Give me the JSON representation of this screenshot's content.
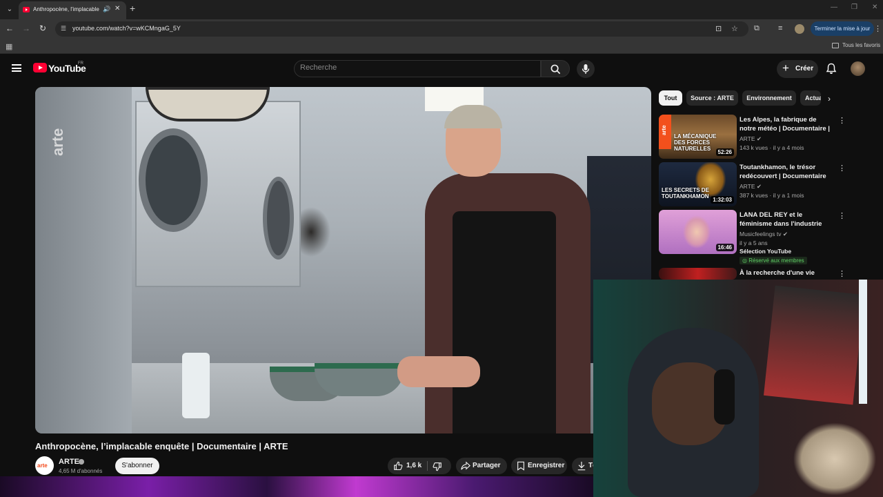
{
  "browser": {
    "tab_title": "Anthropocène, l'implacable enquête | Documentaire | ARTE",
    "url": "youtube.com/watch?v=wKCMngaG_5Y",
    "update_button": "Terminer la mise à jour",
    "bookmarks_all": "Tous les favoris"
  },
  "header": {
    "logo_text": "YouTube",
    "country_code": "FR",
    "search_placeholder": "Recherche",
    "create_label": "Créer"
  },
  "video": {
    "title": "Anthropocène, l’implacable enquête | Documentaire | ARTE",
    "watermark": "arte",
    "channel": {
      "avatar_text": "arte",
      "name": "ARTE",
      "subscribers": "4,65 M d'abonnés",
      "subscribe_label": "S'abonner"
    },
    "actions": {
      "likes": "1,6 k",
      "share": "Partager",
      "save": "Enregistrer",
      "download": "Télécharger"
    }
  },
  "chips": [
    {
      "label": "Tout",
      "active": true
    },
    {
      "label": "Source : ARTE",
      "active": false
    },
    {
      "label": "Environnement",
      "active": false
    },
    {
      "label": "Actualités",
      "active": false
    }
  ],
  "recommendations": [
    {
      "title": "Les Alpes, la fabrique de notre météo | Documentaire | ARTE",
      "channel": "ARTE",
      "meta": "143 k vues · il y a 4 mois",
      "duration": "52:26",
      "thumb_text": "LA MÉCANIQUE DES FORCES NATURELLES",
      "thumb_brand": "arte"
    },
    {
      "title": "Toutankhamon, le trésor redécouvert | Documentaire ...",
      "channel": "ARTE",
      "meta": "387 k vues · il y a 1 mois",
      "duration": "1:32:03",
      "thumb_text": "LES SECRETS DE TOUTANKHAMON"
    },
    {
      "title": "LANA DEL REY et le féminisme dans l'industrie du disque.",
      "channel": "Musicfeelings tv",
      "meta": "il y a 5 ans",
      "duration": "16:46",
      "selection": "Sélection YouTube",
      "badge": "Réservé aux membres"
    },
    {
      "title": "À la recherche d'une vie"
    }
  ],
  "colors": {
    "yt_red": "#ff0033",
    "background": "#0f0f0f",
    "chip_bg": "#272727"
  }
}
